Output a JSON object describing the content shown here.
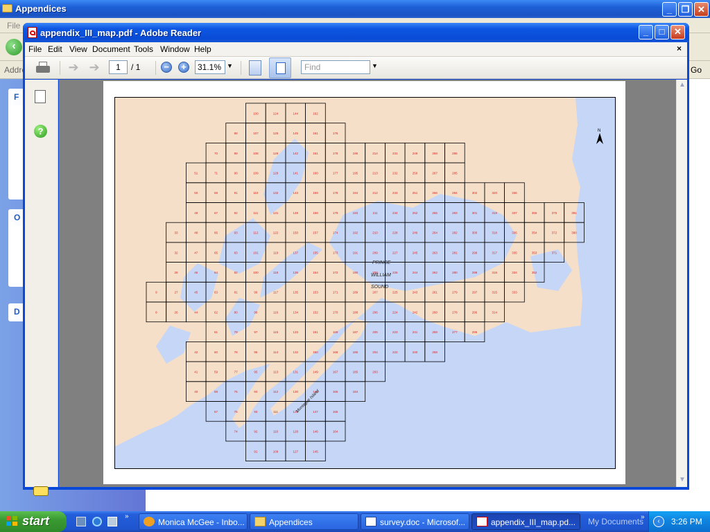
{
  "explorer": {
    "title": "Appendices",
    "menu_first": "File",
    "address_label": "Addre",
    "go_label": "Go",
    "panel_letters": [
      "F",
      "O",
      "D"
    ]
  },
  "reader": {
    "title": "appendix_III_map.pdf - Adobe Reader",
    "menu": [
      "File",
      "Edit",
      "View",
      "Document",
      "Tools",
      "Window",
      "Help"
    ],
    "doc_close": "×",
    "toolbar": {
      "page_current": "1",
      "page_total": "/ 1",
      "zoom": "31.1%",
      "find_placeholder": "Find"
    },
    "window_buttons": {
      "minimize": "_",
      "maximize": "□",
      "close": "✕"
    }
  },
  "map": {
    "north_label": "N",
    "water_labels": [
      "PRINCE",
      "WILLIAM",
      "SOUND"
    ],
    "island_label": "Montague Island",
    "colors": {
      "land": "#f5dfc8",
      "water": "#c6d6f7",
      "grid": "#000000",
      "cell_number": "#e02020"
    },
    "rows": [
      {
        "cells": [
          {
            "c": 5,
            "n": "100"
          },
          {
            "c": 6,
            "n": "124"
          },
          {
            "c": 7,
            "n": "144"
          },
          {
            "c": 8,
            "n": "162"
          }
        ]
      },
      {
        "cells": [
          {
            "c": 4,
            "n": "88"
          },
          {
            "c": 5,
            "n": "107"
          },
          {
            "c": 6,
            "n": "125"
          },
          {
            "c": 7,
            "n": "145"
          },
          {
            "c": 8,
            "n": "161"
          },
          {
            "c": 9,
            "n": "176"
          }
        ]
      },
      {
        "cells": [
          {
            "c": 3,
            "n": "70"
          },
          {
            "c": 4,
            "n": "89"
          },
          {
            "c": 5,
            "n": "108"
          },
          {
            "c": 6,
            "n": "126"
          },
          {
            "c": 7,
            "n": "142"
          },
          {
            "c": 8,
            "n": "161"
          },
          {
            "c": 9,
            "n": "178"
          },
          {
            "c": 10,
            "n": "196"
          },
          {
            "c": 11,
            "n": "214"
          },
          {
            "c": 12,
            "n": "231"
          },
          {
            "c": 13,
            "n": "249"
          },
          {
            "c": 14,
            "n": "268"
          },
          {
            "c": 15,
            "n": "286"
          }
        ]
      },
      {
        "cells": [
          {
            "c": 2,
            "n": "51"
          },
          {
            "c": 3,
            "n": "71"
          },
          {
            "c": 4,
            "n": "90"
          },
          {
            "c": 5,
            "n": "109"
          },
          {
            "c": 6,
            "n": "129"
          },
          {
            "c": 7,
            "n": "141"
          },
          {
            "c": 8,
            "n": "160"
          },
          {
            "c": 9,
            "n": "177"
          },
          {
            "c": 10,
            "n": "195"
          },
          {
            "c": 11,
            "n": "213"
          },
          {
            "c": 12,
            "n": "232"
          },
          {
            "c": 13,
            "n": "250"
          },
          {
            "c": 14,
            "n": "267"
          },
          {
            "c": 15,
            "n": "285"
          }
        ]
      },
      {
        "cells": [
          {
            "c": 2,
            "n": "50"
          },
          {
            "c": 3,
            "n": "69"
          },
          {
            "c": 4,
            "n": "91"
          },
          {
            "c": 5,
            "n": "110"
          },
          {
            "c": 6,
            "n": "132"
          },
          {
            "c": 7,
            "n": "143"
          },
          {
            "c": 8,
            "n": "159"
          },
          {
            "c": 9,
            "n": "178"
          },
          {
            "c": 10,
            "n": "194"
          },
          {
            "c": 11,
            "n": "212"
          },
          {
            "c": 12,
            "n": "233"
          },
          {
            "c": 13,
            "n": "251"
          },
          {
            "c": 14,
            "n": "266"
          },
          {
            "c": 15,
            "n": "284"
          },
          {
            "c": 16,
            "n": "302"
          },
          {
            "c": 17,
            "n": "320"
          },
          {
            "c": 18,
            "n": "336"
          }
        ]
      },
      {
        "cells": [
          {
            "c": 2,
            "n": "49"
          },
          {
            "c": 3,
            "n": "67"
          },
          {
            "c": 4,
            "n": "92"
          },
          {
            "c": 5,
            "n": "111"
          },
          {
            "c": 6,
            "n": "131"
          },
          {
            "c": 7,
            "n": "148"
          },
          {
            "c": 8,
            "n": "158"
          },
          {
            "c": 9,
            "n": "179"
          },
          {
            "c": 10,
            "n": "193"
          },
          {
            "c": 11,
            "n": "211"
          },
          {
            "c": 12,
            "n": "234"
          },
          {
            "c": 13,
            "n": "252"
          },
          {
            "c": 14,
            "n": "265"
          },
          {
            "c": 15,
            "n": "283"
          },
          {
            "c": 16,
            "n": "301"
          },
          {
            "c": 17,
            "n": "319"
          },
          {
            "c": 18,
            "n": "337"
          },
          {
            "c": 19,
            "n": "355"
          },
          {
            "c": 20,
            "n": "375"
          },
          {
            "c": 21,
            "n": "391"
          }
        ]
      },
      {
        "cells": [
          {
            "c": 1,
            "n": "33"
          },
          {
            "c": 2,
            "n": "48"
          },
          {
            "c": 3,
            "n": "66"
          },
          {
            "c": 4,
            "n": "93"
          },
          {
            "c": 5,
            "n": "112"
          },
          {
            "c": 6,
            "n": "122"
          },
          {
            "c": 7,
            "n": "150"
          },
          {
            "c": 8,
            "n": "157"
          },
          {
            "c": 9,
            "n": "174"
          },
          {
            "c": 10,
            "n": "192"
          },
          {
            "c": 11,
            "n": "210"
          },
          {
            "c": 12,
            "n": "228"
          },
          {
            "c": 13,
            "n": "246"
          },
          {
            "c": 14,
            "n": "264"
          },
          {
            "c": 15,
            "n": "282"
          },
          {
            "c": 16,
            "n": "300"
          },
          {
            "c": 17,
            "n": "318"
          },
          {
            "c": 18,
            "n": "336"
          },
          {
            "c": 19,
            "n": "354"
          },
          {
            "c": 20,
            "n": "372"
          },
          {
            "c": 21,
            "n": "390"
          }
        ]
      },
      {
        "cells": [
          {
            "c": 1,
            "n": "32"
          },
          {
            "c": 2,
            "n": "47"
          },
          {
            "c": 3,
            "n": "65"
          },
          {
            "c": 4,
            "n": "83"
          },
          {
            "c": 5,
            "n": "101"
          },
          {
            "c": 6,
            "n": "119"
          },
          {
            "c": 7,
            "n": "137"
          },
          {
            "c": 8,
            "n": "155"
          },
          {
            "c": 9,
            "n": "173"
          },
          {
            "c": 10,
            "n": "191"
          },
          {
            "c": 11,
            "n": "209"
          },
          {
            "c": 12,
            "n": "227"
          },
          {
            "c": 13,
            "n": "245"
          },
          {
            "c": 14,
            "n": "263"
          },
          {
            "c": 15,
            "n": "281"
          },
          {
            "c": 16,
            "n": "299"
          },
          {
            "c": 17,
            "n": "317"
          },
          {
            "c": 18,
            "n": "335"
          },
          {
            "c": 19,
            "n": "353"
          },
          {
            "c": 20,
            "n": "371"
          }
        ]
      },
      {
        "cells": [
          {
            "c": 1,
            "n": "28"
          },
          {
            "c": 2,
            "n": "46"
          },
          {
            "c": 3,
            "n": "64"
          },
          {
            "c": 4,
            "n": "82"
          },
          {
            "c": 5,
            "n": "100"
          },
          {
            "c": 6,
            "n": "118"
          },
          {
            "c": 7,
            "n": "136"
          },
          {
            "c": 8,
            "n": "154"
          },
          {
            "c": 9,
            "n": "172"
          },
          {
            "c": 10,
            "n": "190"
          },
          {
            "c": 11,
            "n": "208"
          },
          {
            "c": 12,
            "n": "226"
          },
          {
            "c": 13,
            "n": "244"
          },
          {
            "c": 14,
            "n": "262"
          },
          {
            "c": 15,
            "n": "280"
          },
          {
            "c": 16,
            "n": "298"
          },
          {
            "c": 17,
            "n": "316"
          },
          {
            "c": 18,
            "n": "334"
          },
          {
            "c": 19,
            "n": "352"
          }
        ]
      },
      {
        "cells": [
          {
            "c": 0,
            "n": "9"
          },
          {
            "c": 1,
            "n": "27"
          },
          {
            "c": 2,
            "n": "45"
          },
          {
            "c": 3,
            "n": "63"
          },
          {
            "c": 4,
            "n": "81"
          },
          {
            "c": 5,
            "n": "99"
          },
          {
            "c": 6,
            "n": "117"
          },
          {
            "c": 7,
            "n": "135"
          },
          {
            "c": 8,
            "n": "153"
          },
          {
            "c": 9,
            "n": "171"
          },
          {
            "c": 10,
            "n": "189"
          },
          {
            "c": 11,
            "n": "207"
          },
          {
            "c": 12,
            "n": "225"
          },
          {
            "c": 13,
            "n": "243"
          },
          {
            "c": 14,
            "n": "261"
          },
          {
            "c": 15,
            "n": "279"
          },
          {
            "c": 16,
            "n": "297"
          },
          {
            "c": 17,
            "n": "315"
          },
          {
            "c": 18,
            "n": "333"
          }
        ]
      },
      {
        "cells": [
          {
            "c": 0,
            "n": "8"
          },
          {
            "c": 1,
            "n": "26"
          },
          {
            "c": 2,
            "n": "44"
          },
          {
            "c": 3,
            "n": "62"
          },
          {
            "c": 4,
            "n": "80"
          },
          {
            "c": 5,
            "n": "98"
          },
          {
            "c": 6,
            "n": "116"
          },
          {
            "c": 7,
            "n": "134"
          },
          {
            "c": 8,
            "n": "152"
          },
          {
            "c": 9,
            "n": "170"
          },
          {
            "c": 10,
            "n": "188"
          },
          {
            "c": 11,
            "n": "206"
          },
          {
            "c": 12,
            "n": "224"
          },
          {
            "c": 13,
            "n": "242"
          },
          {
            "c": 14,
            "n": "260"
          },
          {
            "c": 15,
            "n": "278"
          },
          {
            "c": 16,
            "n": "296"
          },
          {
            "c": 17,
            "n": "314"
          }
        ]
      },
      {
        "cells": [
          {
            "c": 3,
            "n": "61"
          },
          {
            "c": 4,
            "n": "79"
          },
          {
            "c": 5,
            "n": "97"
          },
          {
            "c": 6,
            "n": "115"
          },
          {
            "c": 7,
            "n": "133"
          },
          {
            "c": 8,
            "n": "151"
          },
          {
            "c": 9,
            "n": "169"
          },
          {
            "c": 10,
            "n": "187"
          },
          {
            "c": 11,
            "n": "205"
          },
          {
            "c": 12,
            "n": "223"
          },
          {
            "c": 13,
            "n": "241"
          },
          {
            "c": 14,
            "n": "259"
          },
          {
            "c": 15,
            "n": "277"
          },
          {
            "c": 16,
            "n": "295"
          }
        ]
      },
      {
        "cells": [
          {
            "c": 2,
            "n": "42"
          },
          {
            "c": 3,
            "n": "60"
          },
          {
            "c": 4,
            "n": "78"
          },
          {
            "c": 5,
            "n": "96"
          },
          {
            "c": 6,
            "n": "114"
          },
          {
            "c": 7,
            "n": "132"
          },
          {
            "c": 8,
            "n": "150"
          },
          {
            "c": 9,
            "n": "168"
          },
          {
            "c": 10,
            "n": "186"
          },
          {
            "c": 11,
            "n": "204"
          },
          {
            "c": 12,
            "n": "222"
          },
          {
            "c": 13,
            "n": "240"
          },
          {
            "c": 14,
            "n": "258"
          }
        ]
      },
      {
        "cells": [
          {
            "c": 2,
            "n": "41"
          },
          {
            "c": 3,
            "n": "59"
          },
          {
            "c": 4,
            "n": "77"
          },
          {
            "c": 5,
            "n": "95"
          },
          {
            "c": 6,
            "n": "113"
          },
          {
            "c": 7,
            "n": "131"
          },
          {
            "c": 8,
            "n": "149"
          },
          {
            "c": 9,
            "n": "167"
          },
          {
            "c": 10,
            "n": "185"
          },
          {
            "c": 11,
            "n": "203"
          }
        ]
      },
      {
        "cells": [
          {
            "c": 2,
            "n": "40"
          },
          {
            "c": 3,
            "n": "58"
          },
          {
            "c": 4,
            "n": "76"
          },
          {
            "c": 5,
            "n": "94"
          },
          {
            "c": 6,
            "n": "112"
          },
          {
            "c": 7,
            "n": "130"
          },
          {
            "c": 8,
            "n": "148"
          },
          {
            "c": 9,
            "n": "166"
          },
          {
            "c": 10,
            "n": "184"
          }
        ]
      },
      {
        "cells": [
          {
            "c": 3,
            "n": "57"
          },
          {
            "c": 4,
            "n": "75"
          },
          {
            "c": 5,
            "n": "93"
          },
          {
            "c": 6,
            "n": "111"
          },
          {
            "c": 7,
            "n": "129"
          },
          {
            "c": 8,
            "n": "147"
          },
          {
            "c": 9,
            "n": "165"
          }
        ]
      },
      {
        "cells": [
          {
            "c": 4,
            "n": "74"
          },
          {
            "c": 5,
            "n": "92"
          },
          {
            "c": 6,
            "n": "110"
          },
          {
            "c": 7,
            "n": "128"
          },
          {
            "c": 8,
            "n": "146"
          },
          {
            "c": 9,
            "n": "164"
          }
        ]
      },
      {
        "cells": [
          {
            "c": 5,
            "n": "91"
          },
          {
            "c": 6,
            "n": "109"
          },
          {
            "c": 7,
            "n": "127"
          },
          {
            "c": 8,
            "n": "145"
          }
        ]
      }
    ]
  },
  "taskbar": {
    "start": "start",
    "tasks": [
      {
        "label": "Monica McGee - Inbo...",
        "active": false
      },
      {
        "label": "Appendices",
        "active": false
      },
      {
        "label": "survey.doc - Microsof...",
        "active": false
      },
      {
        "label": "appendix_III_map.pd...",
        "active": true
      }
    ],
    "my_documents": "My Documents",
    "more_arrow": "»",
    "clock": "3:26 PM"
  }
}
